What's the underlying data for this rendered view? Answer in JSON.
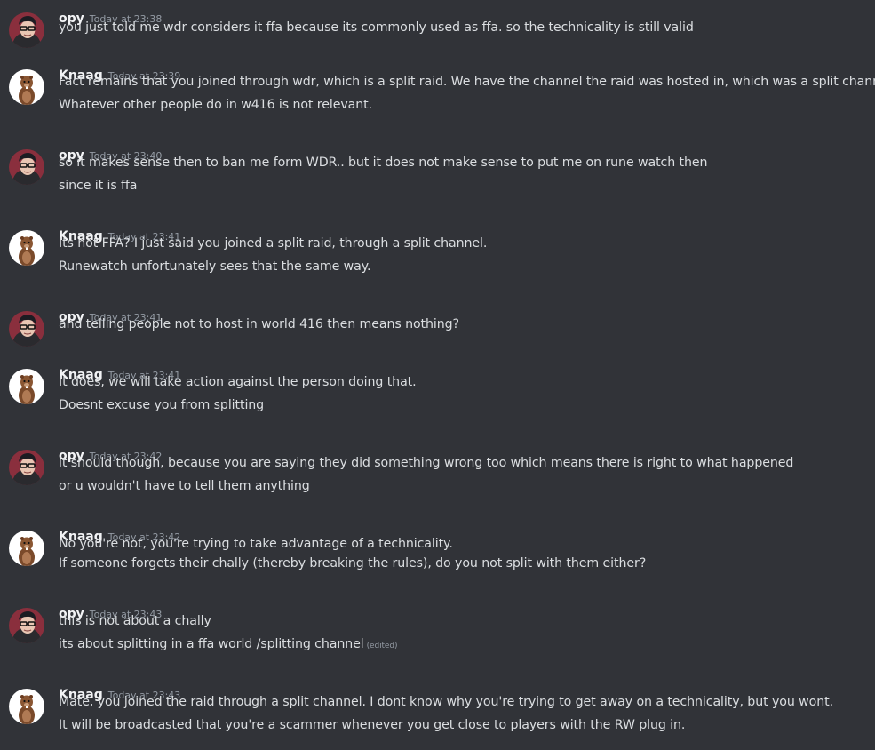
{
  "messages": [
    {
      "author": "opy",
      "avatar": "opy-avatar",
      "timestamp": "Today at 23:38",
      "lines": [
        {
          "text": "you just told me wdr considers it ffa because its commonly used as ffa. so the technicality is still valid"
        }
      ]
    },
    {
      "author": "Knaag",
      "avatar": "beaver-avatar",
      "timestamp": "Today at 23:39",
      "lines": [
        {
          "text": "Fact remains that you joined through wdr, which is a split raid. We have the channel the raid was hosted in, which was a split channel."
        },
        {
          "text": "Whatever other people do in w416 is not relevant."
        }
      ]
    },
    {
      "author": "opy",
      "avatar": "opy-avatar",
      "timestamp": "Today at 23:40",
      "lines": [
        {
          "text": "so it makes sense then to ban me form WDR.. but it does not make sense to put me on rune watch then"
        },
        {
          "text": "since it is ffa"
        }
      ]
    },
    {
      "author": "Knaag",
      "avatar": "beaver-avatar",
      "timestamp": "Today at 23:41",
      "lines": [
        {
          "text": "Its not FFA? I just said you joined a split raid, through a split channel."
        },
        {
          "text": "Runewatch unfortunately sees that the same way."
        }
      ]
    },
    {
      "author": "opy",
      "avatar": "opy-avatar",
      "timestamp": "Today at 23:41",
      "lines": [
        {
          "text": "and telling people not to host in world 416 then means nothing?"
        }
      ]
    },
    {
      "author": "Knaag",
      "avatar": "beaver-avatar",
      "timestamp": "Today at 23:41",
      "lines": [
        {
          "text": "It does, we will take action against the person doing that."
        },
        {
          "text": "Doesnt excuse you from splitting"
        }
      ]
    },
    {
      "author": "opy",
      "avatar": "opy-avatar",
      "timestamp": "Today at 23:42",
      "lines": [
        {
          "text": "it should though, because you are saying they did something wrong too which means there is right to what happened"
        },
        {
          "text": "or u wouldn't have to tell them anything"
        }
      ]
    },
    {
      "author": "Knaag",
      "avatar": "beaver-avatar",
      "timestamp": "Today at 23:42",
      "lines": [
        {
          "text": "No you're not, you're trying to take advantage of a technicality."
        },
        {
          "text": "If someone forgets their chally (thereby breaking the rules), do you not split with them either?"
        }
      ]
    },
    {
      "author": "opy",
      "avatar": "opy-avatar",
      "timestamp": "Today at 23:43",
      "lines": [
        {
          "text": "this is not about a chally"
        },
        {
          "text": "its about splitting in a ffa world /splitting channel",
          "edited": "(edited)"
        }
      ]
    },
    {
      "author": "Knaag",
      "avatar": "beaver-avatar",
      "timestamp": "Today at 23:43",
      "lines": [
        {
          "text": "Mate, you joined the raid through a split channel. I dont know why you're trying to get away on a technicality, but you wont."
        },
        {
          "text": "It will be broadcasted that you're a scammer whenever you get close to players with the RW plug in."
        }
      ]
    }
  ],
  "colors": {
    "background": "#313338",
    "author": "#f2f3f5",
    "text": "#dbdee1",
    "muted": "#949ba4"
  }
}
